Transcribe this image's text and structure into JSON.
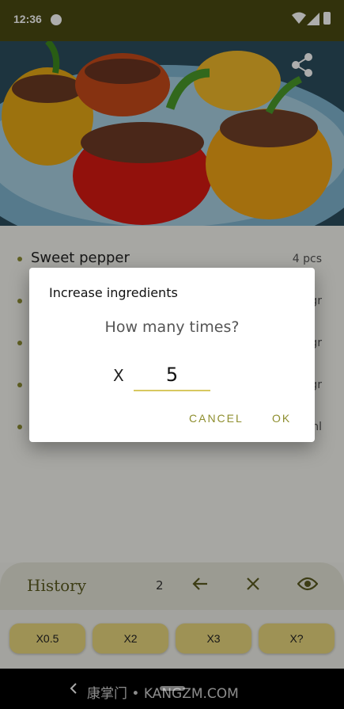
{
  "status": {
    "time": "12:36"
  },
  "ingredients": [
    {
      "name": "Sweet pepper",
      "qty": "4 pcs"
    },
    {
      "name": "",
      "qty": "gr"
    },
    {
      "name": "",
      "qty": "gr"
    },
    {
      "name": "",
      "qty": "gr"
    },
    {
      "name": "",
      "qty": "ml"
    }
  ],
  "history": {
    "label": "History",
    "count": "2"
  },
  "multipliers": [
    "X0.5",
    "X2",
    "X3",
    "X?"
  ],
  "dialog": {
    "title": "Increase ingredients",
    "question": "How many times?",
    "x_label": "X",
    "value": "5",
    "cancel": "CANCEL",
    "ok": "OK"
  },
  "navbar": {
    "watermark": "康掌门 • KANGZM.COM"
  },
  "colors": {
    "accent": "#e9d77e",
    "dialog_button": "#8e8e2e",
    "statusbar": "#4a4a12"
  }
}
